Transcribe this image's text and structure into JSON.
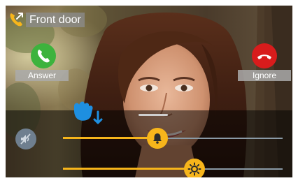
{
  "call": {
    "title": "Front door",
    "answer_label": "Answer",
    "ignore_label": "Ignore"
  },
  "controls": {
    "volume_level": 0.43,
    "brightness_level": 0.6
  },
  "icons": {
    "title": "door-phone-icon",
    "answer": "phone-icon",
    "ignore": "hang-up-icon",
    "mute": "speaker-muted-icon",
    "volume_thumb": "bell-icon",
    "brightness_thumb": "sun-icon",
    "cursor": "hand-pointer-icon"
  },
  "colors": {
    "accent": "#f7b51b",
    "answer": "#3db33d",
    "ignore": "#d81c1c",
    "label_bg": "#aaaaaa",
    "track": "#8a9aa6"
  }
}
